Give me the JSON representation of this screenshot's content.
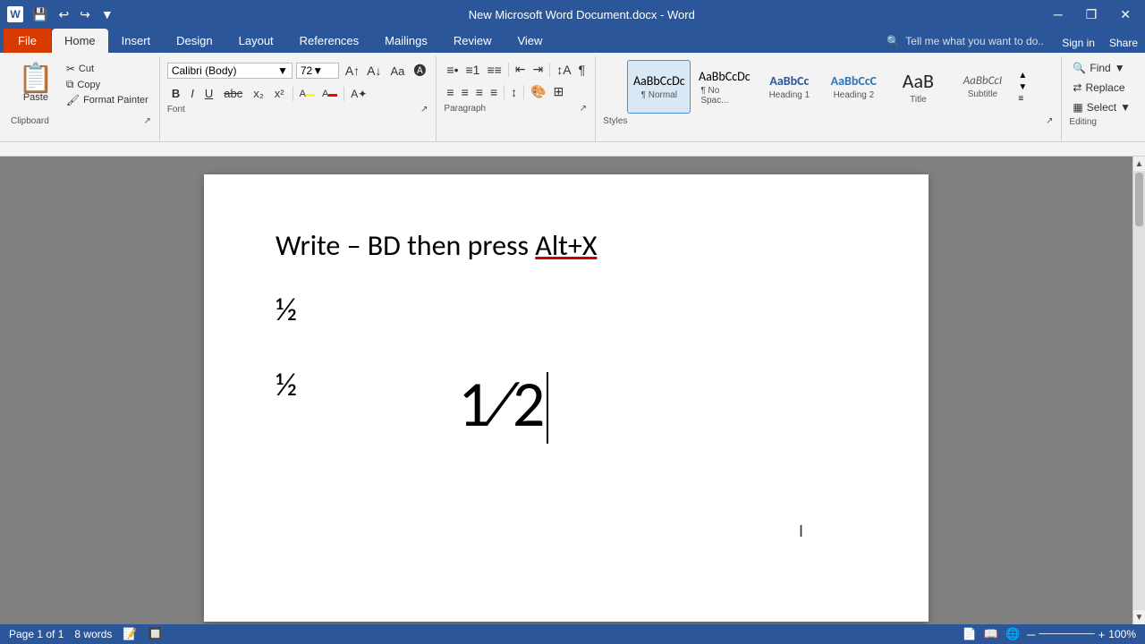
{
  "titlebar": {
    "title": "New Microsoft Word Document.docx - Word",
    "quickaccess": [
      "save",
      "undo",
      "redo",
      "customize"
    ],
    "buttons": [
      "minimize",
      "restore",
      "close"
    ]
  },
  "ribbon": {
    "tabs": [
      "File",
      "Home",
      "Insert",
      "Design",
      "Layout",
      "References",
      "Mailings",
      "Review",
      "View"
    ],
    "active_tab": "Home",
    "search_placeholder": "Tell me what you want to do...",
    "sign_in": "Sign in",
    "share": "Share"
  },
  "clipboard": {
    "paste_label": "Paste",
    "cut_label": "Cut",
    "copy_label": "Copy",
    "format_painter_label": "Format Painter"
  },
  "font": {
    "family": "Calibri (Body)",
    "size": "72",
    "bold": "B",
    "italic": "I",
    "underline": "U",
    "strikethrough": "abc",
    "subscript": "x₂",
    "superscript": "x²"
  },
  "styles": {
    "items": [
      {
        "label": "Normal",
        "preview": "AaBbCcDc",
        "active": true
      },
      {
        "label": "No Spac...",
        "preview": "AaBbCcDc",
        "active": false
      },
      {
        "label": "Heading 1",
        "preview": "AaBbCc",
        "active": false
      },
      {
        "label": "Heading 2",
        "preview": "AaBbCcC",
        "active": false
      },
      {
        "label": "Title",
        "preview": "AaB",
        "active": false
      },
      {
        "label": "Subtitle",
        "preview": "AaBbCcI",
        "active": false
      }
    ]
  },
  "editing": {
    "find_label": "Find",
    "replace_label": "Replace",
    "select_label": "Select"
  },
  "groups": {
    "clipboard": "Clipboard",
    "font": "Font",
    "paragraph": "Paragraph",
    "styles": "Styles",
    "editing": "Editing"
  },
  "document": {
    "line1": "Write – BD then press Alt+X",
    "line1_underlined": "Alt+X",
    "fraction_small_1": "½",
    "fraction_small_2": "½",
    "fraction_large": "1⁄2",
    "cursor_visible": true
  },
  "statusbar": {
    "page_info": "Page 1 of 1",
    "word_count": "8 words",
    "language": "",
    "zoom": "100%",
    "view_icons": [
      "print-layout",
      "read-mode",
      "web-layout"
    ]
  }
}
